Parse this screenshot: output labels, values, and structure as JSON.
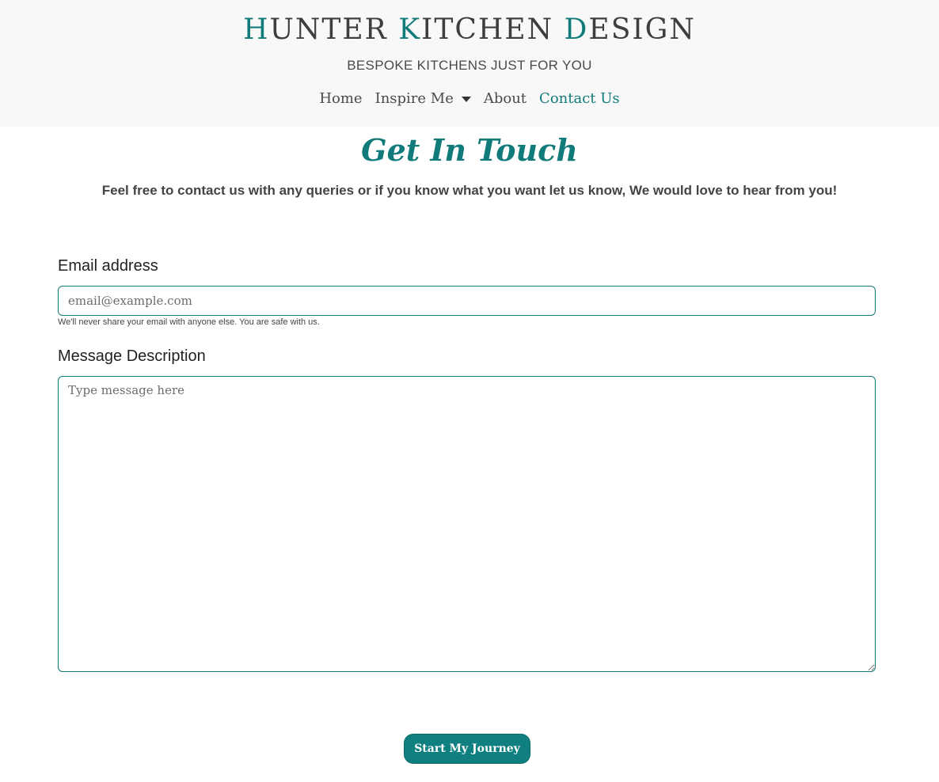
{
  "header": {
    "brand": {
      "parts": [
        {
          "text": "H",
          "accent": true
        },
        {
          "text": "UNTER ",
          "accent": false
        },
        {
          "text": "K",
          "accent": true
        },
        {
          "text": "ITCHEN ",
          "accent": false
        },
        {
          "text": "D",
          "accent": true
        },
        {
          "text": "ESIGN",
          "accent": false
        }
      ]
    },
    "tagline": "BESPOKE KITCHENS JUST FOR YOU",
    "nav": {
      "home": "Home",
      "inspire": "Inspire Me",
      "about": "About",
      "contact": "Contact Us"
    }
  },
  "main": {
    "heading": "Get In Touch",
    "intro": "Feel free to contact us with any queries or if you know what you want let us know, We would love to hear from you!",
    "form": {
      "email_label": "Email address",
      "email_placeholder": "email@example.com",
      "email_help": "We'll never share your email with anyone else. You are safe with us.",
      "message_label": "Message Description",
      "message_placeholder": "Type message here",
      "submit_label": "Start My Journey"
    }
  },
  "colors": {
    "accent": "#117a7a",
    "button": "#0f7f7f",
    "header_bg": "#f8f8f8"
  }
}
